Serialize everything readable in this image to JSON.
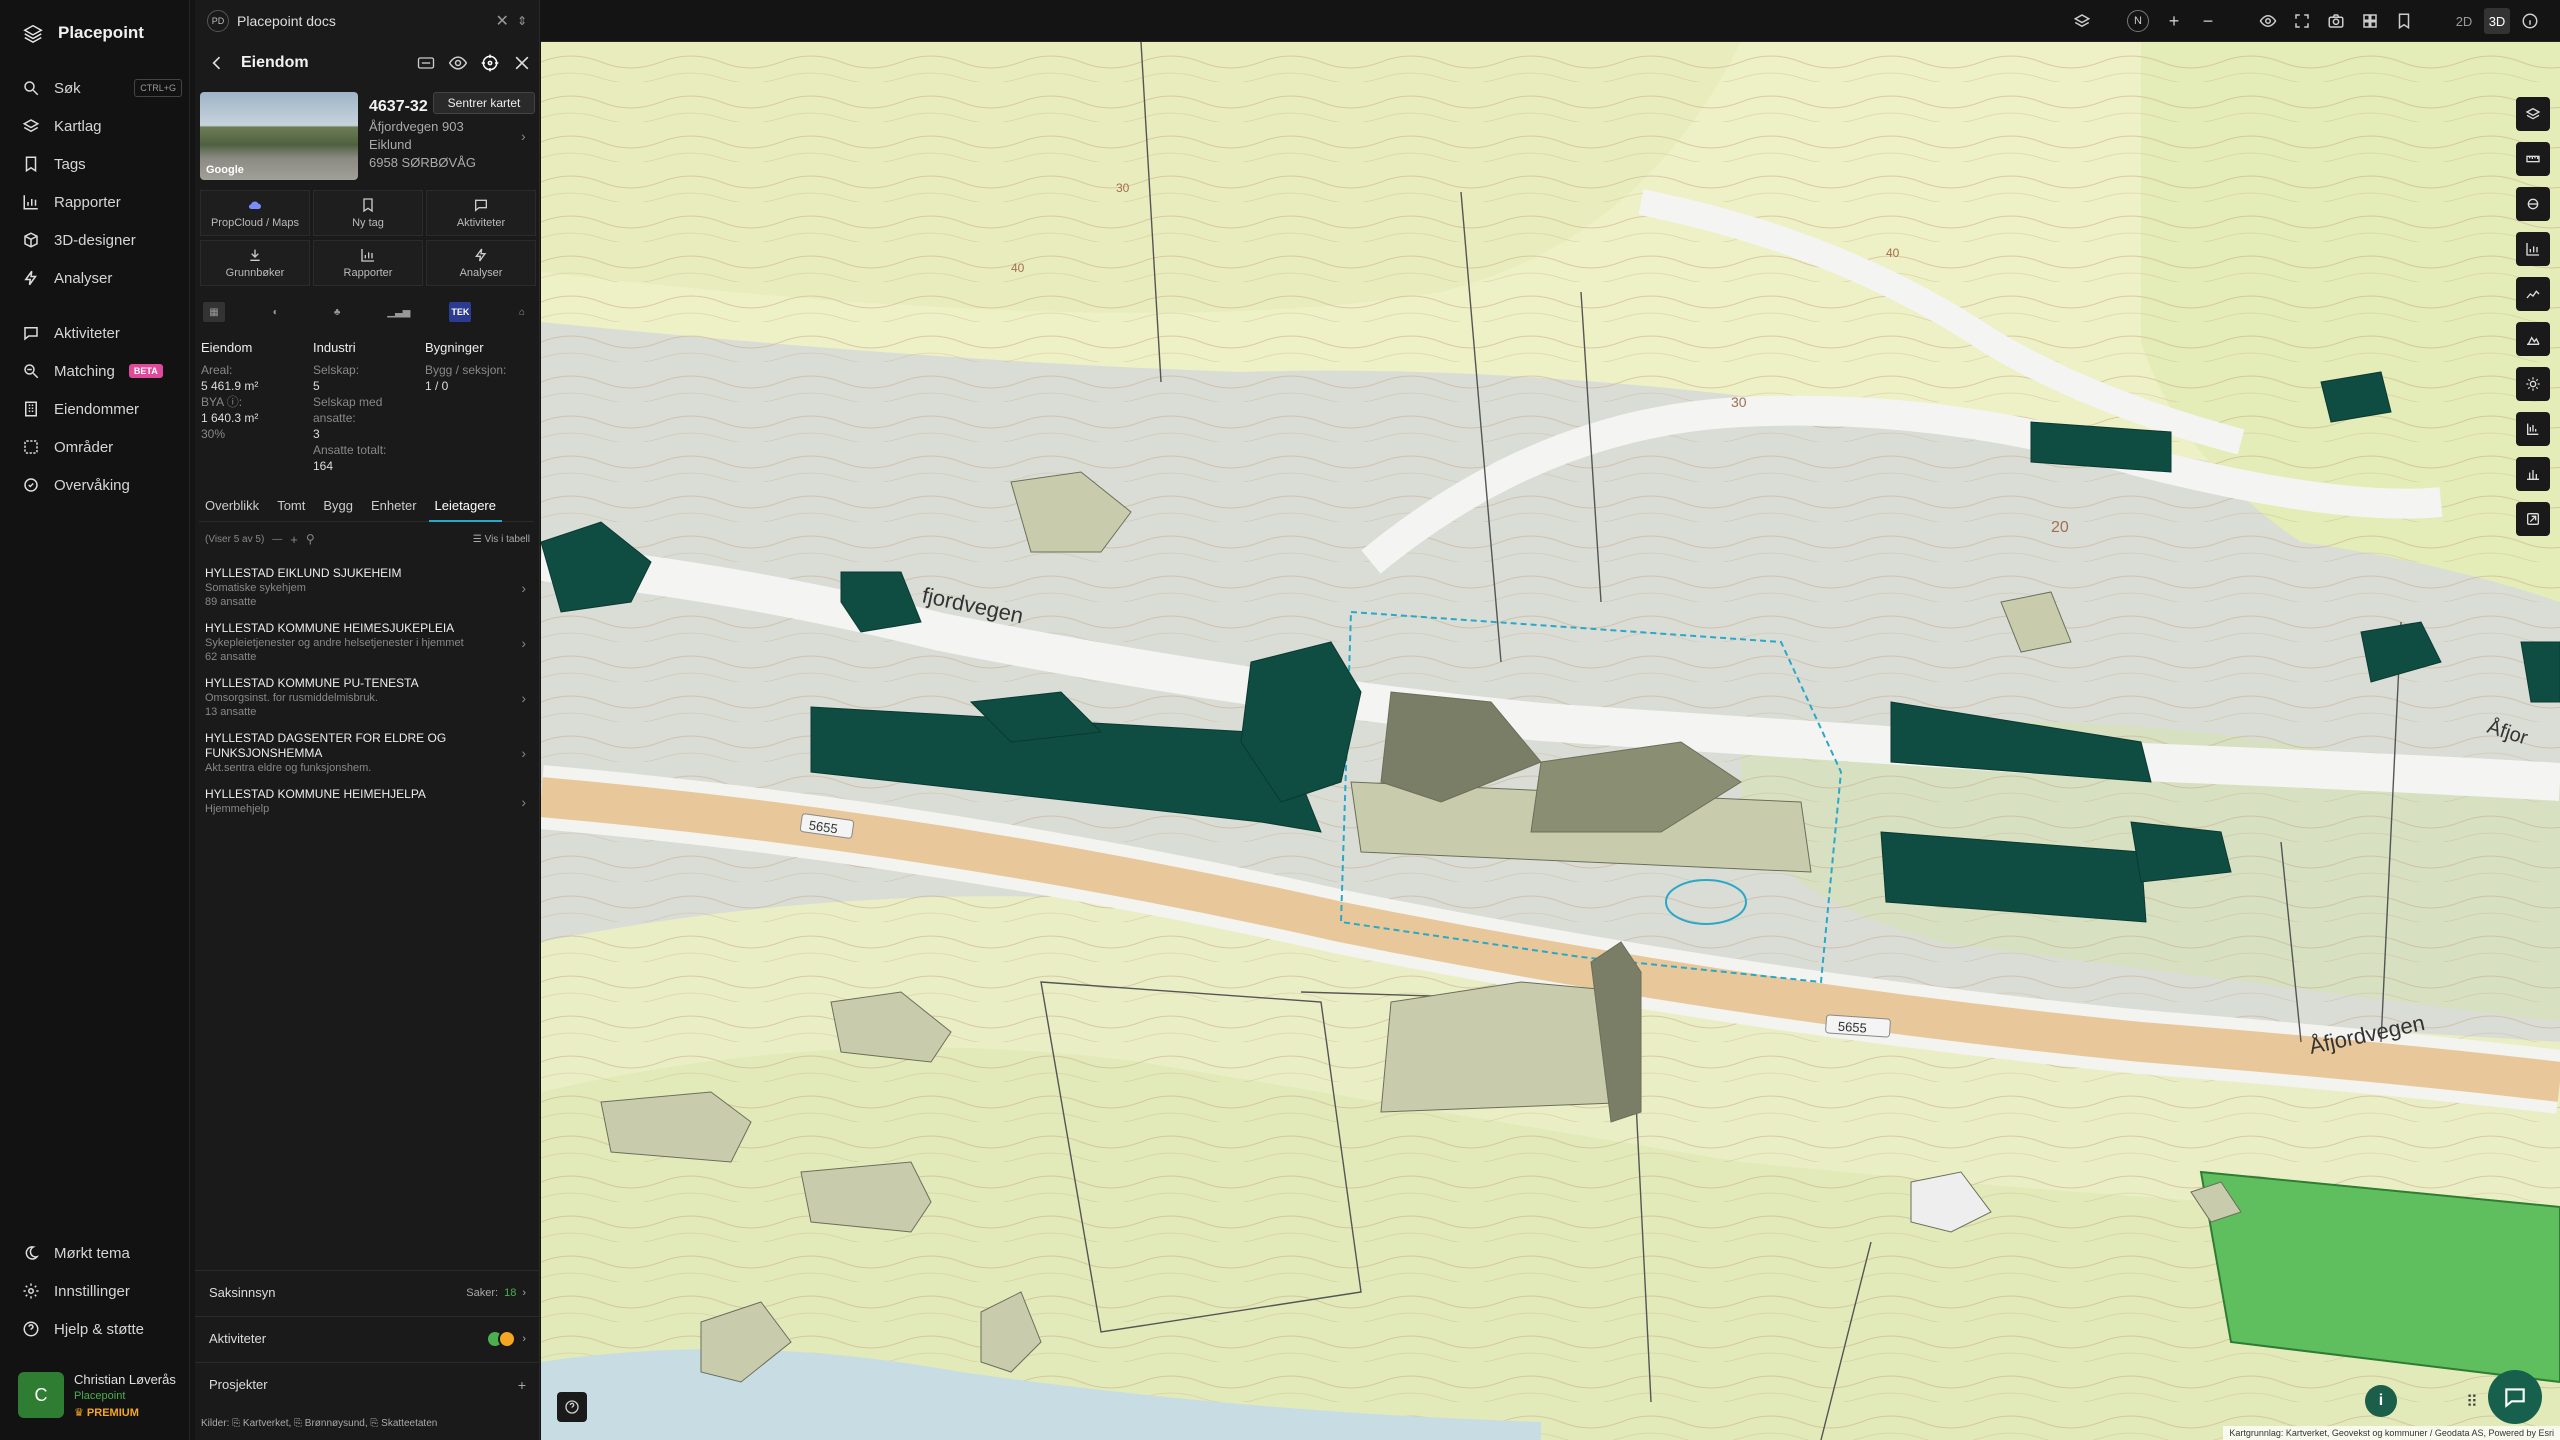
{
  "nav": {
    "brand": "Placepoint",
    "items": [
      {
        "label": "Søk",
        "icon": "search-icon",
        "kbd": "CTRL+G"
      },
      {
        "label": "Kartlag",
        "icon": "layers-icon"
      },
      {
        "label": "Tags",
        "icon": "bookmark-icon"
      },
      {
        "label": "Rapporter",
        "icon": "bar-chart-icon"
      },
      {
        "label": "3D-designer",
        "icon": "cube-icon"
      },
      {
        "label": "Analyser",
        "icon": "bolt-icon"
      },
      {
        "label": "Aktiviteter",
        "icon": "chat-icon"
      },
      {
        "label": "Matching",
        "icon": "match-icon",
        "badge": "BETA"
      },
      {
        "label": "Eiendommer",
        "icon": "building-icon"
      },
      {
        "label": "Områder",
        "icon": "area-icon"
      },
      {
        "label": "Overvåking",
        "icon": "watch-icon"
      }
    ],
    "bottom": [
      {
        "label": "Mørkt tema",
        "icon": "moon-icon"
      },
      {
        "label": "Innstillinger",
        "icon": "gear-icon"
      },
      {
        "label": "Hjelp & støtte",
        "icon": "help-icon"
      }
    ],
    "user": {
      "initial": "C",
      "name": "Christian Løverås",
      "org": "Placepoint",
      "plan": "PREMIUM"
    }
  },
  "panel": {
    "workspace": {
      "logo": "PD",
      "name": "Placepoint docs"
    },
    "title": "Eiendom",
    "tooltip": "Sentrer kartet",
    "thumb_label": "Google",
    "property": {
      "gnr": "4637-32",
      "street": "Åfjordvegen 903",
      "place": "Eiklund",
      "postal": "6958 SØRBØVÅG"
    },
    "actions": [
      {
        "label": "PropCloud / Maps",
        "icon": "cloud-icon"
      },
      {
        "label": "Ny tag",
        "icon": "bookmark-icon"
      },
      {
        "label": "Aktiviteter",
        "icon": "chat-icon"
      },
      {
        "label": "Grunnbøker",
        "icon": "download-icon"
      },
      {
        "label": "Rapporter",
        "icon": "bar-chart-icon"
      },
      {
        "label": "Analyser",
        "icon": "bolt-icon"
      }
    ],
    "cat_tek": "TEK",
    "stats": {
      "eiendom": {
        "h": "Eiendom",
        "areal_l": "Areal:",
        "areal_v": "5 461.9 m²",
        "bya_l": "BYA ⓘ:",
        "bya_v": "1 640.3 m²",
        "bya_pct": "30%"
      },
      "industri": {
        "h": "Industri",
        "selskap_l": "Selskap:",
        "selskap_v": "5",
        "ansatte_l": "Selskap med ansatte:",
        "ansatte_v": "3",
        "tot_l": "Ansatte totalt:",
        "tot_v": "164"
      },
      "bygninger": {
        "h": "Bygninger",
        "bygg_l": "Bygg / seksjon:",
        "bygg_v": "1 / 0"
      }
    },
    "tabs": [
      "Overblikk",
      "Tomt",
      "Bygg",
      "Enheter",
      "Leietagere"
    ],
    "active_tab": 4,
    "filter": {
      "count": "(Viser 5 av 5)",
      "view": "Vis i tabell"
    },
    "tenants": [
      {
        "name": "HYLLESTAD EIKLUND SJUKEHEIM",
        "desc": "Somatiske sykehjem",
        "emp": "89 ansatte"
      },
      {
        "name": "HYLLESTAD KOMMUNE HEIMESJUKEPLEIA",
        "desc": "Sykepleietjenester og andre helsetjenester i hjemmet",
        "emp": "62 ansatte"
      },
      {
        "name": "HYLLESTAD KOMMUNE PU-TENESTA",
        "desc": "Omsorgsinst. for rusmiddelmisbruk.",
        "emp": "13 ansatte"
      },
      {
        "name": "HYLLESTAD DAGSENTER FOR ELDRE OG FUNKSJONSHEMMA",
        "desc": "Akt.sentra eldre og funksjonshem.",
        "emp": ""
      },
      {
        "name": "HYLLESTAD KOMMUNE HEIMEHJELPA",
        "desc": "Hjemmehjelp",
        "emp": ""
      }
    ],
    "sections": {
      "saksinnsyn": "Saksinnsyn",
      "saker_label": "Saker:",
      "saker_count": "18",
      "aktiviteter": "Aktiviteter",
      "prosjekter": "Prosjekter",
      "add": "+"
    },
    "sources": "Kilder: ⎘ Kartverket, ⎘ Brønnøysund, ⎘ Skatteetaten"
  },
  "map": {
    "topbar": {
      "north": "N",
      "plus": "+",
      "minus": "−",
      "mode_2d": "2D",
      "mode_3d": "3D"
    },
    "labels": {
      "road1": "Åfjordvegen",
      "road2": "Åfjordvegen",
      "road_partial": "fjordvegen",
      "road_right": "Åfjor",
      "route_a": "5655",
      "route_b": "5655",
      "c30a": "30",
      "c40": "40",
      "c30b": "30",
      "c20": "20",
      "c50": "40"
    },
    "attribution": "Kartgrunnlag: Kartverket, Geovekst og kommuner / Geodata AS, Powered by Esri"
  },
  "colors": {
    "accent": "#2aa8c8",
    "building_teal": "#0f4c42",
    "building_olive": "#6b6f5a",
    "road": "#e8c89b",
    "grass": "#eef2c0",
    "brand_green": "#17604d"
  }
}
